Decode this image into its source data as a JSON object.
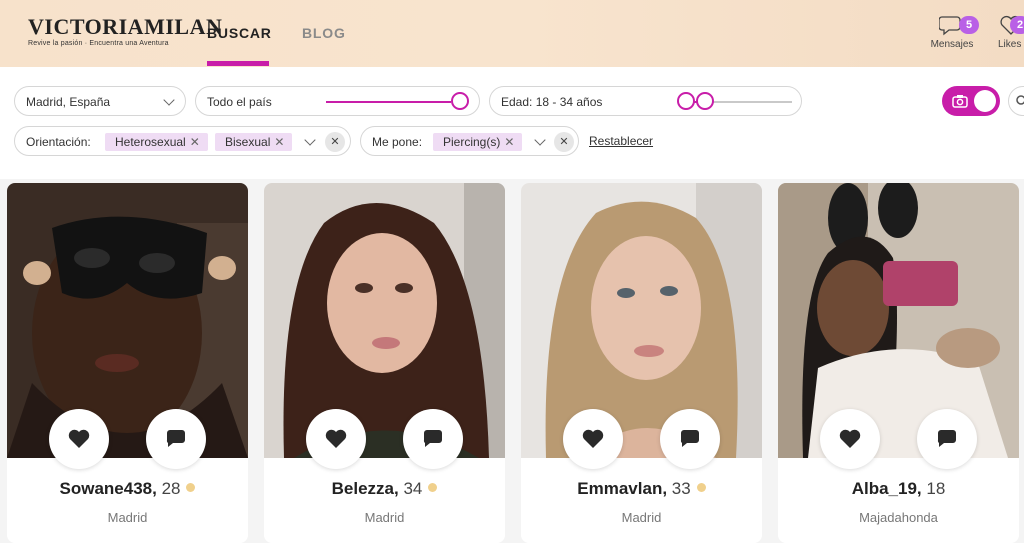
{
  "header": {
    "logo_name": "VICTORIAMILAN",
    "logo_tagline": "Revive la pasión · Encuentra una Aventura",
    "nav": {
      "buscar": "BUSCAR",
      "blog": "BLOG"
    },
    "messages": {
      "label": "Mensajes",
      "count": "5"
    },
    "likes": {
      "label": "Likes",
      "count": "2"
    }
  },
  "filters": {
    "location": "Madrid, España",
    "scope": "Todo el país",
    "age": "Edad: 18 - 34 años",
    "orientation": {
      "label": "Orientación:",
      "chips": [
        "Heterosexual",
        "Bisexual"
      ]
    },
    "turn_on": {
      "label": "Me pone:",
      "chips": [
        "Piercing(s)"
      ]
    },
    "reset": "Restablecer"
  },
  "profiles": [
    {
      "name": "Sowane438,",
      "age": "28",
      "city": "Madrid",
      "online": true
    },
    {
      "name": "Belezza,",
      "age": "34",
      "city": "Madrid",
      "online": true
    },
    {
      "name": "Emmavlan,",
      "age": "33",
      "city": "Madrid",
      "online": true
    },
    {
      "name": "Alba_19,",
      "age": "18",
      "city": "Majadahonda",
      "online": false
    }
  ],
  "colors": {
    "accent": "#c81da9",
    "badge": "#b960e6",
    "online": "#f0d08c",
    "chip": "#efdcf4"
  }
}
